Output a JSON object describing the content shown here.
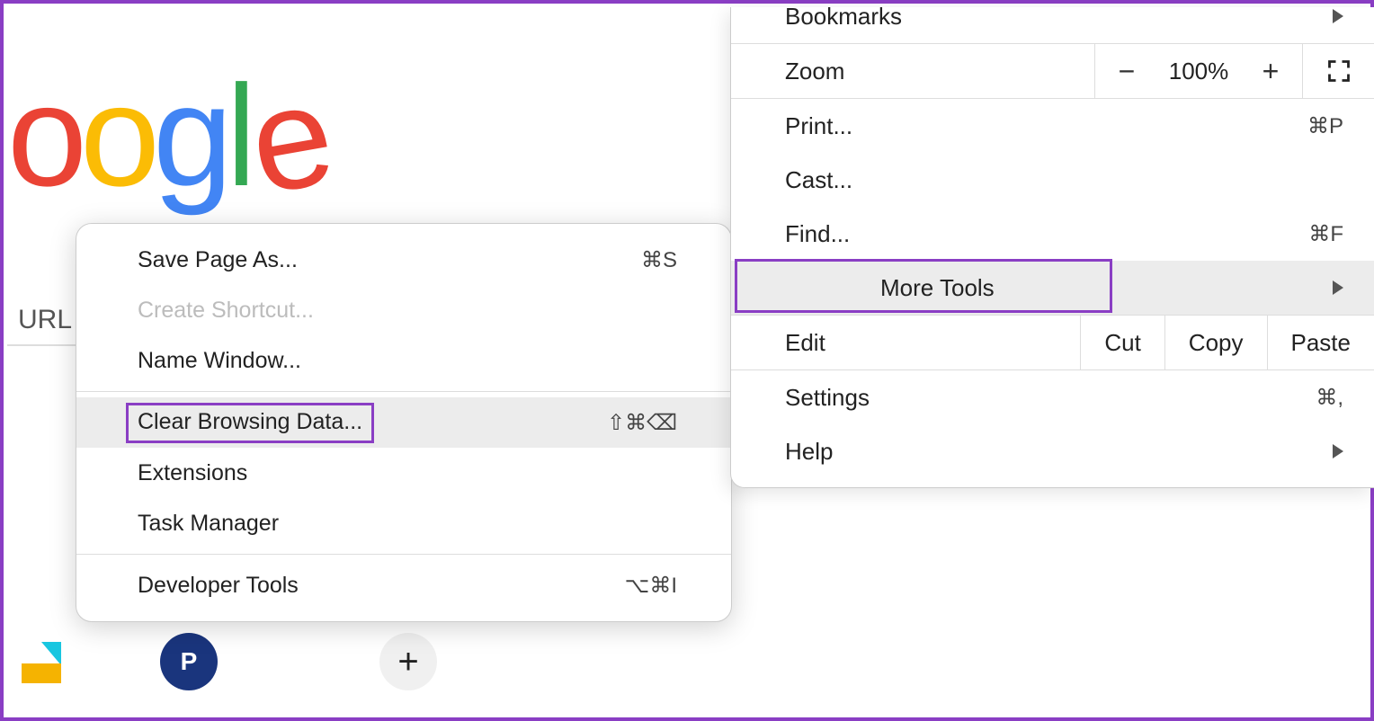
{
  "background": {
    "url_label": "URL"
  },
  "submenu": {
    "items": [
      {
        "label": "Save Page As...",
        "shortcut": "⌘S",
        "disabled": false
      },
      {
        "label": "Create Shortcut...",
        "shortcut": "",
        "disabled": true
      },
      {
        "label": "Name Window...",
        "shortcut": "",
        "disabled": false
      }
    ],
    "highlighted": {
      "label": "Clear Browsing Data...",
      "shortcut": "⇧⌘⌫"
    },
    "items2": [
      {
        "label": "Extensions",
        "shortcut": ""
      },
      {
        "label": "Task Manager",
        "shortcut": ""
      }
    ],
    "items3": [
      {
        "label": "Developer Tools",
        "shortcut": "⌥⌘I"
      }
    ]
  },
  "main_menu": {
    "bookmarks": "Bookmarks",
    "zoom_label": "Zoom",
    "zoom_value": "100%",
    "print": {
      "label": "Print...",
      "shortcut": "⌘P"
    },
    "cast": "Cast...",
    "find": {
      "label": "Find...",
      "shortcut": "⌘F"
    },
    "more_tools": "More Tools",
    "edit": {
      "label": "Edit",
      "cut": "Cut",
      "copy": "Copy",
      "paste": "Paste"
    },
    "settings": {
      "label": "Settings",
      "shortcut": "⌘,"
    },
    "help": "Help"
  },
  "icons": {
    "p_initial": "P",
    "plus": "+"
  }
}
